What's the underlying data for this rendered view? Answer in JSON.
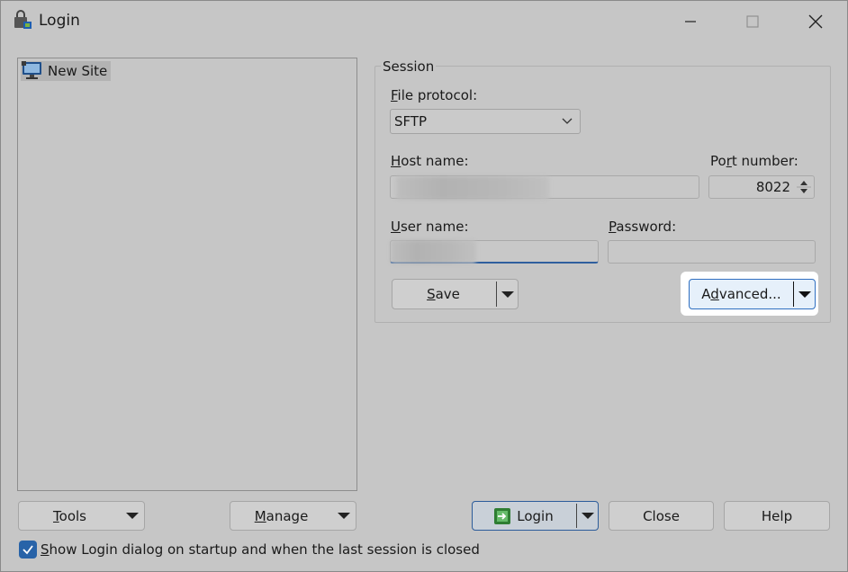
{
  "window": {
    "title": "Login"
  },
  "site_tree": {
    "items": [
      {
        "label": "New Site",
        "icon": "monitor-icon"
      }
    ]
  },
  "session": {
    "group_label": "Session",
    "file_protocol": {
      "label_accel": "F",
      "label_rest": "ile protocol:",
      "value": "SFTP"
    },
    "host_name": {
      "label_accel": "H",
      "label_rest": "ost name:",
      "value": ""
    },
    "port_number": {
      "label_pre": "Po",
      "label_accel": "r",
      "label_rest": "t number:",
      "value": "8022"
    },
    "user_name": {
      "label_accel": "U",
      "label_rest": "ser name:",
      "value": ""
    },
    "password": {
      "label_accel": "P",
      "label_rest": "assword:",
      "value": ""
    },
    "save_button": {
      "accel": "S",
      "rest": "ave"
    },
    "advanced_button": {
      "pre": "A",
      "accel": "d",
      "rest": "vanced..."
    }
  },
  "bottom": {
    "tools": {
      "accel": "T",
      "rest": "ools"
    },
    "manage": {
      "accel": "M",
      "rest": "anage"
    },
    "login": "Login",
    "close": "Close",
    "help": "Help",
    "checkbox": {
      "checked": true,
      "accel": "S",
      "rest": "how Login dialog on startup and when the last session is closed"
    }
  }
}
